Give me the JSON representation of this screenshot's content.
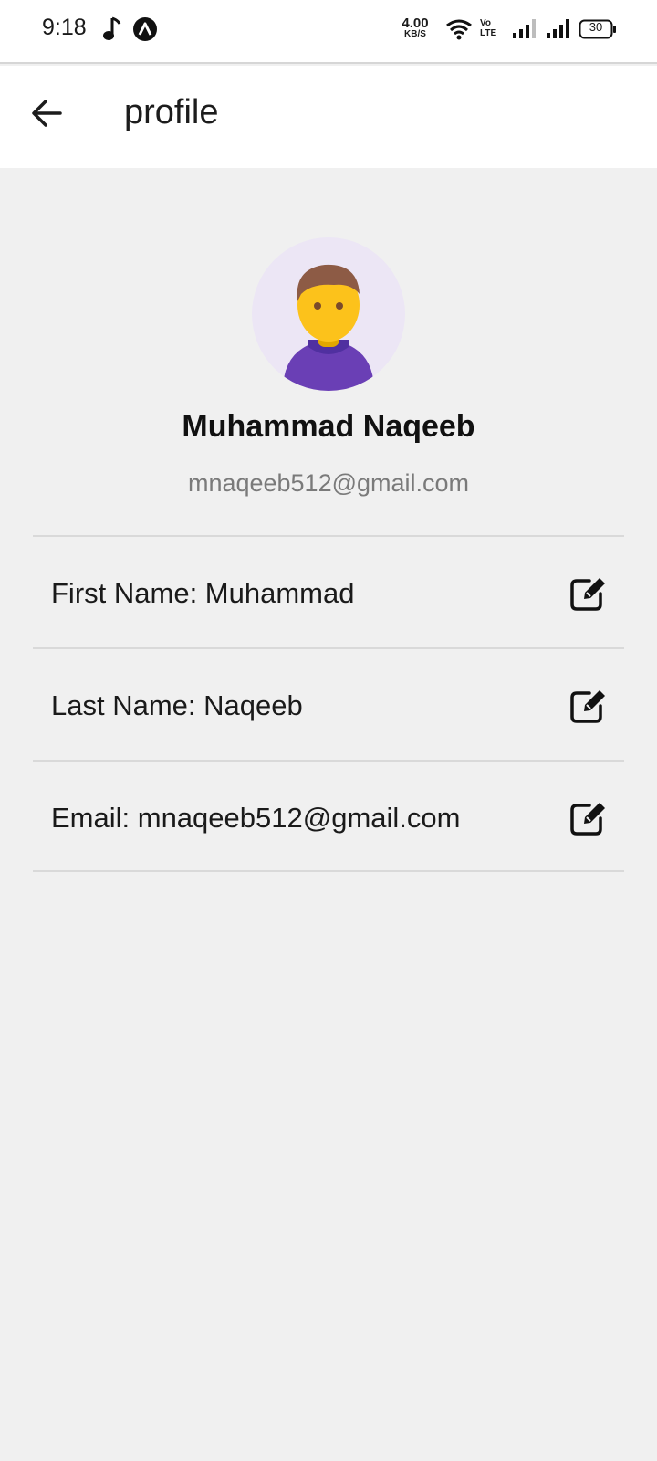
{
  "status_bar": {
    "time": "9:18",
    "net_speed_value": "4.00",
    "net_speed_unit": "KB/S",
    "volte_top": "Vo",
    "volte_bottom": "LTE",
    "battery": "30",
    "icons": [
      "music-note-icon",
      "a-notification-icon",
      "wifi-icon",
      "volte-icon",
      "signal-icon",
      "signal-icon",
      "battery-icon"
    ]
  },
  "app_bar": {
    "back_icon": "arrow-left-icon",
    "title": "profile"
  },
  "profile": {
    "avatar_icon": "person-avatar-icon",
    "name": "Muhammad Naqeeb",
    "email": "mnaqeeb512@gmail.com"
  },
  "fields": [
    {
      "text": "First Name: Muhammad",
      "edit_icon": "edit-icon"
    },
    {
      "text": "Last Name: Naqeeb",
      "edit_icon": "edit-icon"
    },
    {
      "text": "Email: mnaqeeb512@gmail.com",
      "edit_icon": "edit-icon"
    }
  ],
  "colors": {
    "background": "#f0f0f0",
    "app_bar": "#ffffff",
    "avatar_bg": "#ece6f5",
    "avatar_shirt": "#6a3fb5",
    "avatar_face": "#fcc21b",
    "avatar_hair": "#8d5b45",
    "secondary_text": "#7a7a7a",
    "divider": "#d9d9d9"
  }
}
